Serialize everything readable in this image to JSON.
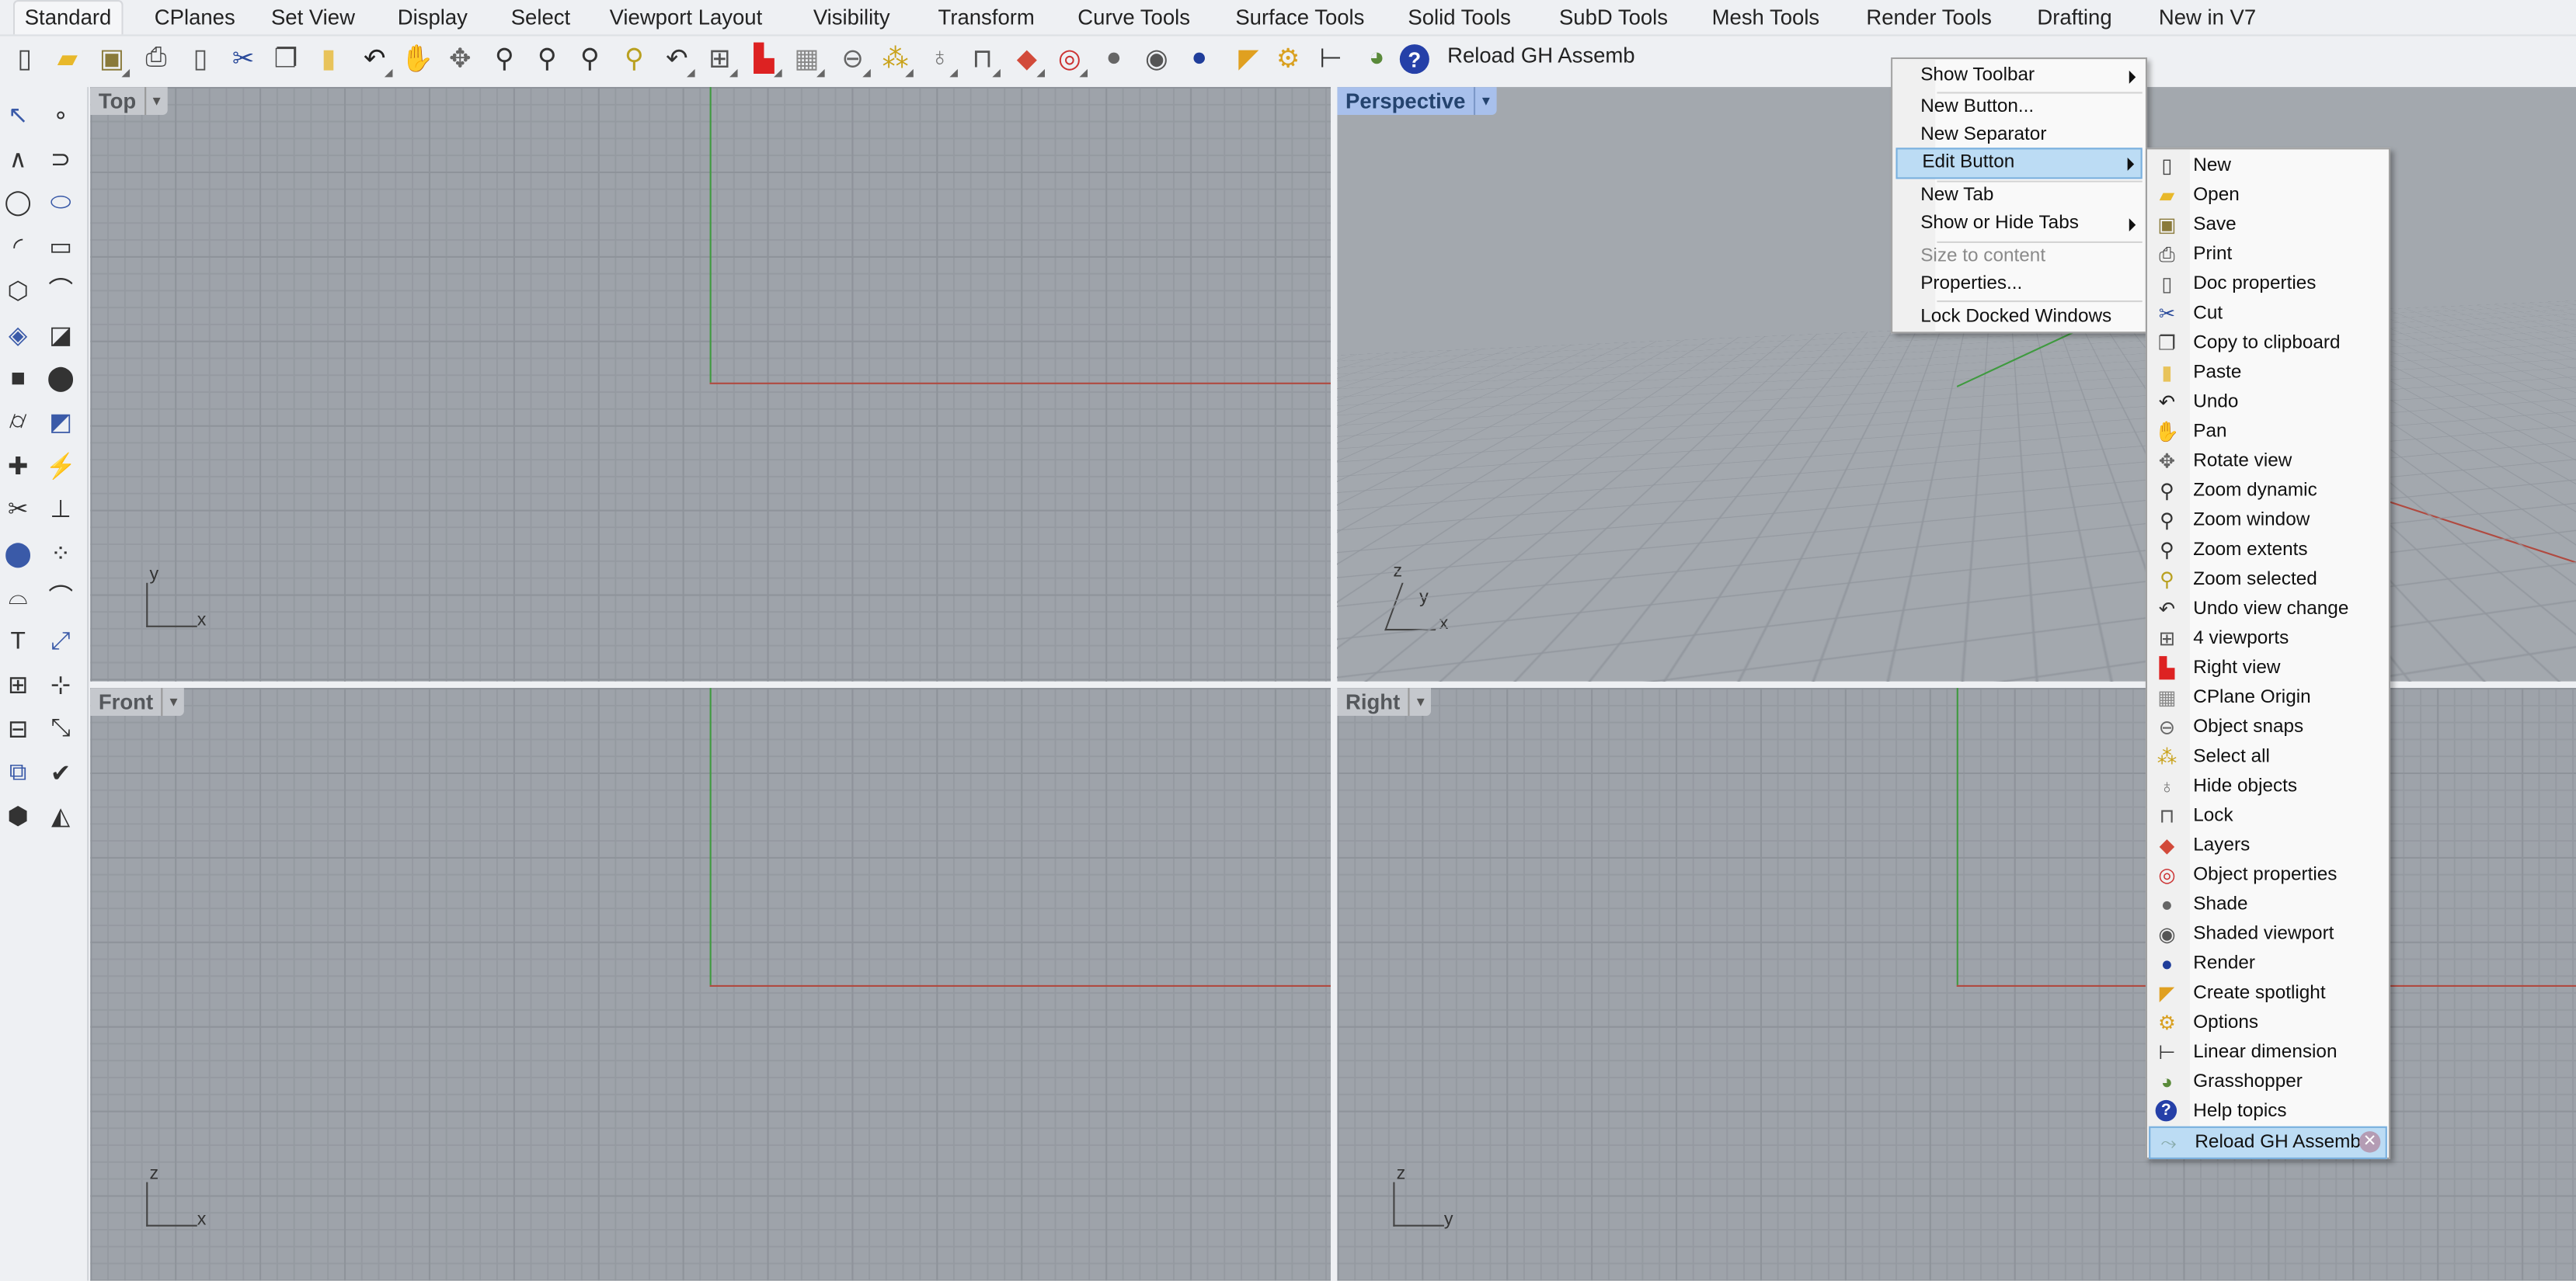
{
  "tabs": [
    "Standard",
    "CPlanes",
    "Set View",
    "Display",
    "Select",
    "Viewport Layout",
    "Visibility",
    "Transform",
    "Curve Tools",
    "Surface Tools",
    "Solid Tools",
    "SubD Tools",
    "Mesh Tools",
    "Render Tools",
    "Drafting",
    "New in V7"
  ],
  "active_tab": "Standard",
  "toolbar": {
    "icons": [
      "new-icon",
      "open-icon",
      "save-icon",
      "print-icon",
      "doc-properties-icon",
      "cut-icon",
      "copy-icon",
      "paste-icon",
      "undo-icon",
      "pan-icon",
      "rotate-view-icon",
      "zoom-dynamic-icon",
      "zoom-window-icon",
      "zoom-extents-icon",
      "zoom-selected-icon",
      "undo-view-change-icon",
      "four-viewports-icon",
      "right-view-icon",
      "cplane-origin-icon",
      "object-snaps-icon",
      "select-all-icon",
      "hide-objects-icon",
      "lock-icon",
      "layers-icon",
      "object-properties-icon",
      "shade-icon",
      "shaded-viewport-icon",
      "render-icon",
      "create-spotlight-icon",
      "options-icon",
      "linear-dimension-icon",
      "grasshopper-icon",
      "help-topics-icon"
    ],
    "text_button": "Reload GH Assemb"
  },
  "left_toolbar": {
    "icons": [
      "select-arrow-icon",
      "point-icon",
      "polyline-icon",
      "curve-icon",
      "circle-icon",
      "ellipse-icon",
      "arc-icon",
      "rectangle-icon",
      "polygon-icon",
      "fillet-icon",
      "surface-icon",
      "extrude-icon",
      "box-icon",
      "boolean-icon",
      "cylinder-icon",
      "mesh-icon",
      "gumball-icon",
      "explode-icon",
      "trim-icon",
      "split-icon",
      "group-icon",
      "points-icon",
      "curve-from-object-icon",
      "blend-icon",
      "text-icon",
      "transform-icon",
      "array-icon",
      "dimension-icon",
      "array-grid-icon",
      "align-icon",
      "analyze-icon",
      "check-icon",
      "render-object-icon",
      "light-icon"
    ]
  },
  "viewports": [
    {
      "label": "Top",
      "active": false,
      "axes": [
        "y",
        "x"
      ]
    },
    {
      "label": "Perspective",
      "active": true,
      "axes": [
        "z",
        "y",
        "x"
      ]
    },
    {
      "label": "Front",
      "active": false,
      "axes": [
        "z",
        "x"
      ]
    },
    {
      "label": "Right",
      "active": false,
      "axes": [
        "z",
        "y"
      ]
    }
  ],
  "context_menu": {
    "items": [
      {
        "label": "Show Toolbar",
        "submenu": true
      },
      {
        "label": "New Button..."
      },
      {
        "label": "New Separator"
      },
      {
        "label": "Edit Button",
        "submenu": true,
        "highlighted": true
      },
      {
        "label": "New Tab"
      },
      {
        "label": "Show or Hide Tabs",
        "submenu": true
      },
      {
        "label": "Size to content",
        "disabled": true
      },
      {
        "label": "Properties..."
      },
      {
        "label": "Lock Docked Windows"
      }
    ]
  },
  "edit_button_submenu": {
    "items": [
      {
        "label": "New",
        "icon": "new-icon"
      },
      {
        "label": "Open",
        "icon": "open-icon"
      },
      {
        "label": "Save",
        "icon": "save-icon"
      },
      {
        "label": "Print",
        "icon": "print-icon"
      },
      {
        "label": "Doc properties",
        "icon": "doc-properties-icon"
      },
      {
        "label": "Cut",
        "icon": "cut-icon"
      },
      {
        "label": "Copy to clipboard",
        "icon": "copy-icon"
      },
      {
        "label": "Paste",
        "icon": "paste-icon"
      },
      {
        "label": "Undo",
        "icon": "undo-icon"
      },
      {
        "label": "Pan",
        "icon": "pan-icon"
      },
      {
        "label": "Rotate view",
        "icon": "rotate-view-icon"
      },
      {
        "label": "Zoom dynamic",
        "icon": "zoom-dynamic-icon"
      },
      {
        "label": "Zoom window",
        "icon": "zoom-window-icon"
      },
      {
        "label": "Zoom extents",
        "icon": "zoom-extents-icon"
      },
      {
        "label": "Zoom selected",
        "icon": "zoom-selected-icon"
      },
      {
        "label": "Undo view change",
        "icon": "undo-view-change-icon"
      },
      {
        "label": "4 viewports",
        "icon": "four-viewports-icon"
      },
      {
        "label": "Right view",
        "icon": "right-view-icon"
      },
      {
        "label": "CPlane Origin",
        "icon": "cplane-origin-icon"
      },
      {
        "label": "Object snaps",
        "icon": "object-snaps-icon"
      },
      {
        "label": "Select all",
        "icon": "select-all-icon"
      },
      {
        "label": "Hide objects",
        "icon": "hide-objects-icon"
      },
      {
        "label": "Lock",
        "icon": "lock-icon"
      },
      {
        "label": "Layers",
        "icon": "layers-icon"
      },
      {
        "label": "Object properties",
        "icon": "object-properties-icon"
      },
      {
        "label": "Shade",
        "icon": "shade-icon"
      },
      {
        "label": "Shaded viewport",
        "icon": "shaded-viewport-icon"
      },
      {
        "label": "Render",
        "icon": "render-icon"
      },
      {
        "label": "Create spotlight",
        "icon": "create-spotlight-icon"
      },
      {
        "label": "Options",
        "icon": "options-icon"
      },
      {
        "label": "Linear dimension",
        "icon": "linear-dimension-icon"
      },
      {
        "label": "Grasshopper",
        "icon": "grasshopper-icon"
      },
      {
        "label": "Help topics",
        "icon": "help-topics-icon"
      },
      {
        "label": "Reload GH Assemb",
        "icon": "script-icon",
        "highlighted": true,
        "removable": true
      }
    ]
  },
  "colors": {
    "menu_highlight": "#bcdcf4",
    "active_viewport_label": "#a8c0ec",
    "x_axis": "#b04a40",
    "y_axis": "#3f9a3f",
    "viewport_bg": "#9ea3aa"
  }
}
